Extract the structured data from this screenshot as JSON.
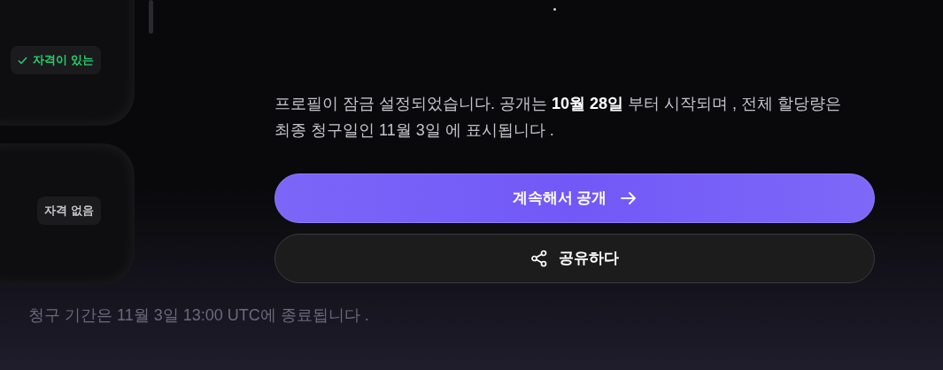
{
  "cards": [
    {
      "badge": "자격이 있는",
      "eligible": true
    },
    {
      "badge": "자격 없음",
      "eligible": false
    }
  ],
  "message": "프로필이 잠금 설정되었습니다. 공개는 **10월 28일** 부터 시작되며 , 전체 할당량은 최종 청구일인 11월 3일 에 표시됩니다 .",
  "buttons": [
    {
      "label": "계속해서 공개",
      "kind": "primary"
    },
    {
      "label": "공유하다",
      "kind": "secondary"
    }
  ],
  "footer": "청구 기간은 11월 3일 13:00 UTC에 종료됩니다 ."
}
